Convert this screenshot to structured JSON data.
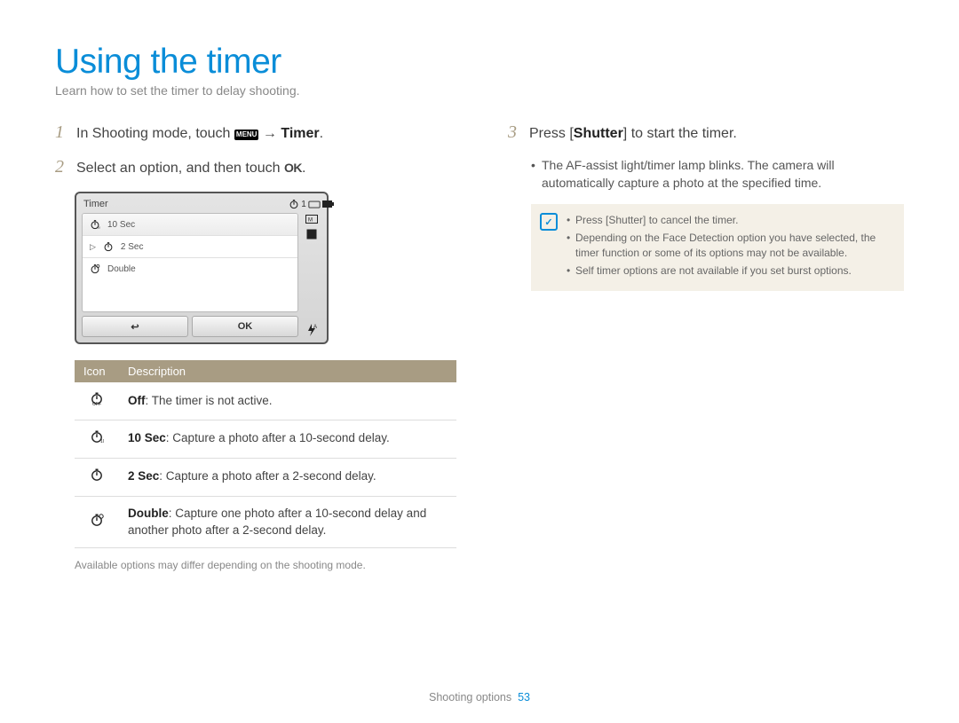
{
  "title": "Using the timer",
  "subtitle": "Learn how to set the timer to delay shooting.",
  "steps": {
    "s1_pre": "In Shooting mode, touch ",
    "s1_menu": "MENU",
    "s1_post": " → ",
    "s1_bold": "Timer",
    "s1_end": ".",
    "s2_pre": "Select an option, and then touch ",
    "s2_ok": "OK",
    "s2_end": ".",
    "s3_pre": "Press [",
    "s3_bold": "Shutter",
    "s3_post": "] to start the timer."
  },
  "camera": {
    "title": "Timer",
    "right_num": "1",
    "items": [
      "10 Sec",
      "2 Sec",
      "Double"
    ],
    "back": "↩",
    "ok": "OK"
  },
  "table": {
    "h1": "Icon",
    "h2": "Description",
    "rows": [
      {
        "b": "Off",
        "t": ": The timer is not active."
      },
      {
        "b": "10 Sec",
        "t": ": Capture a photo after a 10-second delay."
      },
      {
        "b": "2 Sec",
        "t": ": Capture a photo after a 2-second delay."
      },
      {
        "b": "Double",
        "t": ": Capture one photo after a 10-second delay and another photo after a 2-second delay."
      }
    ]
  },
  "opts_note": "Available options may differ depending on the shooting mode.",
  "right": {
    "bullet1": "The AF-assist light/timer lamp blinks. The camera will automatically capture a photo at the specified time.",
    "info1_pre": "Press [",
    "info1_b": "Shutter",
    "info1_post": "] to cancel the timer.",
    "info2": "Depending on the Face Detection option you have selected, the timer function or some of its options may not be available.",
    "info3": "Self timer options are not available if you set burst options."
  },
  "footer": {
    "section": "Shooting options",
    "page": "53"
  }
}
